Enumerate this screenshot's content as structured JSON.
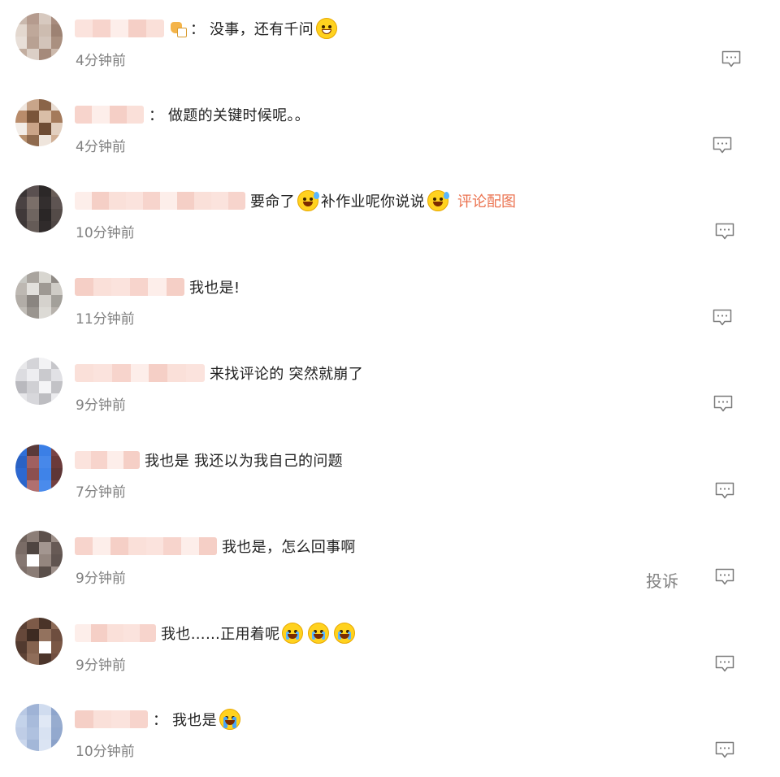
{
  "comments": [
    {
      "segments": [
        {
          "type": "sticker",
          "icon": "hand-sticker-icon"
        },
        {
          "type": "colon",
          "value": "："
        },
        {
          "type": "text",
          "value": "没事，还有千问"
        },
        {
          "type": "emoji",
          "icon": "laughing-emoji-icon",
          "style": "laugh"
        }
      ],
      "time": "4分钟前"
    },
    {
      "segments": [
        {
          "type": "colon",
          "value": "："
        },
        {
          "type": "text",
          "value": "做题的关键时候呢。。"
        }
      ],
      "time": "4分钟前"
    },
    {
      "segments": [
        {
          "type": "text",
          "value": "要命了"
        },
        {
          "type": "emoji",
          "icon": "sweating-emoji-icon",
          "style": "sweat"
        },
        {
          "type": "text",
          "value": "补作业呢你说说"
        },
        {
          "type": "emoji",
          "icon": "sweating-emoji-icon",
          "style": "sweat"
        },
        {
          "type": "link",
          "value": "评论配图"
        }
      ],
      "time": "10分钟前"
    },
    {
      "segments": [
        {
          "type": "text",
          "value": "我也是!"
        }
      ],
      "time": "11分钟前"
    },
    {
      "segments": [
        {
          "type": "text",
          "value": "来找评论的 突然就崩了"
        }
      ],
      "time": "9分钟前"
    },
    {
      "segments": [
        {
          "type": "text",
          "value": "我也是 我还以为我自己的问题"
        }
      ],
      "time": "7分钟前"
    },
    {
      "segments": [
        {
          "type": "text",
          "value": "我也是，怎么回事啊"
        }
      ],
      "time": "9分钟前",
      "report": "投诉"
    },
    {
      "segments": [
        {
          "type": "text",
          "value": "我也……正用着呢"
        },
        {
          "type": "emoji",
          "icon": "crying-laughing-emoji-icon",
          "style": "cry"
        },
        {
          "type": "emoji",
          "icon": "crying-laughing-emoji-icon",
          "style": "cry"
        },
        {
          "type": "emoji",
          "icon": "crying-laughing-emoji-icon",
          "style": "cry"
        }
      ],
      "time": "9分钟前"
    },
    {
      "segments": [
        {
          "type": "colon",
          "value": "："
        },
        {
          "type": "text",
          "value": "我也是"
        },
        {
          "type": "emoji",
          "icon": "sobbing-emoji-icon",
          "style": "sob"
        }
      ],
      "time": "10分钟前"
    }
  ],
  "colors": {
    "link": "#eb7350",
    "time": "#808080",
    "text": "#222222"
  }
}
